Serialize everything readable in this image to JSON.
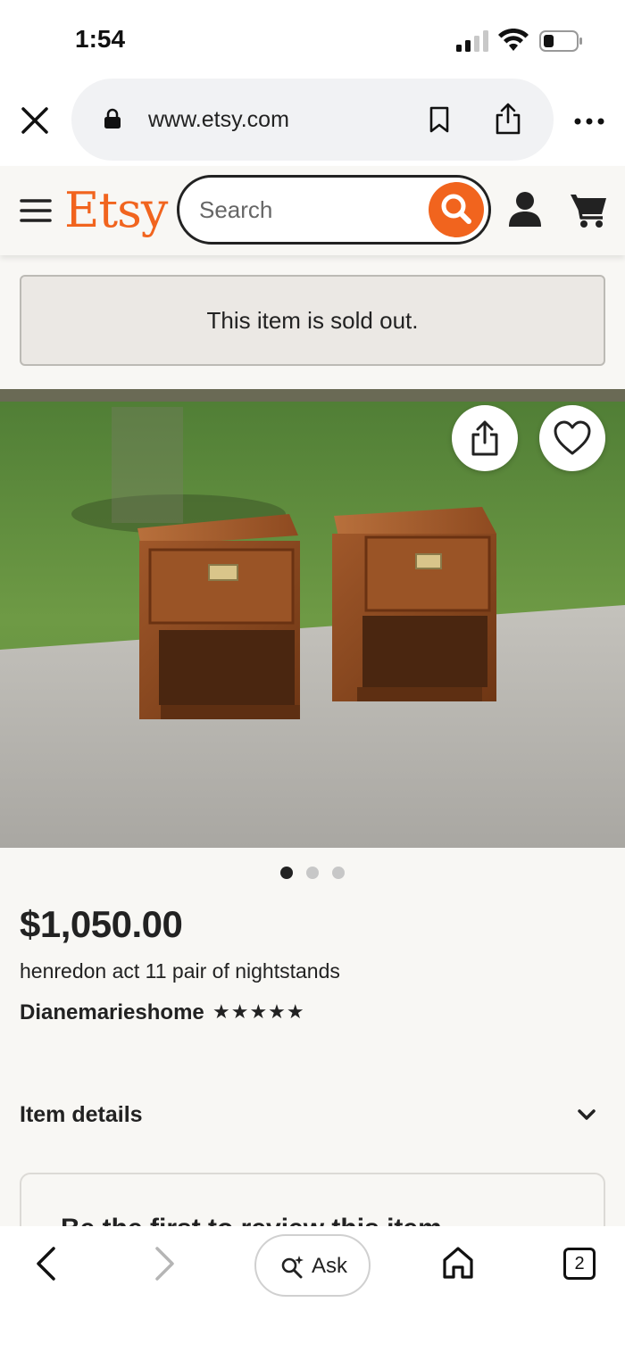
{
  "status_bar": {
    "time": "1:54"
  },
  "browser": {
    "url": "www.etsy.com"
  },
  "header": {
    "logo": "Etsy",
    "search_placeholder": "Search"
  },
  "banner": {
    "text": "This item is sold out."
  },
  "carousel": {
    "total": 3,
    "active": 1
  },
  "product": {
    "price": "$1,050.00",
    "title": "henredon act 11 pair of nightstands",
    "shop": "Dianemarieshome",
    "rating": 5,
    "stars": "★★★★★"
  },
  "sections": {
    "item_details": "Item details",
    "card_text": "Be the first to review this item"
  },
  "toolbar": {
    "ask_label": "Ask",
    "tab_count": "2"
  },
  "colors": {
    "brand": "#f1641e",
    "text": "#222222",
    "page_bg": "#f8f7f4"
  }
}
